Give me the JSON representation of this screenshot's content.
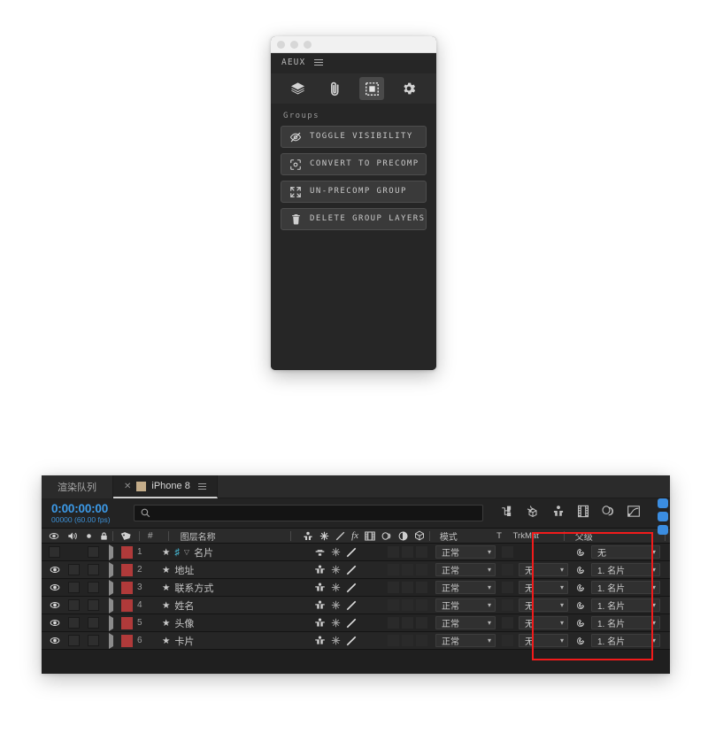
{
  "aeux_panel": {
    "window_controls": [
      "close",
      "minimize",
      "maximize"
    ],
    "title": "AEUX",
    "menu_icon": "hamburger-menu-icon",
    "toolbar_icons": [
      {
        "name": "layers-icon",
        "active": false
      },
      {
        "name": "paperclip-icon",
        "active": false
      },
      {
        "name": "group-selection-icon",
        "active": true
      },
      {
        "name": "gear-icon",
        "active": false
      }
    ],
    "section_label": "Groups",
    "buttons": [
      {
        "icon": "eye-off-icon",
        "label": "TOGGLE VISIBILITY"
      },
      {
        "icon": "precomp-icon",
        "label": "CONVERT TO PRECOMP"
      },
      {
        "icon": "expand-icon",
        "label": "UN-PRECOMP GROUP"
      },
      {
        "icon": "trash-icon",
        "label": "DELETE GROUP LAYERS"
      }
    ]
  },
  "ae_timeline": {
    "tabs": [
      {
        "label": "渲染队列",
        "active": false,
        "closable": false
      },
      {
        "label": "iPhone 8",
        "active": true,
        "closable": true
      }
    ],
    "timecode": "0:00:00:00",
    "frames_fps": "00000 (60.00 fps)",
    "search": {
      "placeholder": "",
      "value": "",
      "icon": "search-icon"
    },
    "toolbar_icons": [
      "composition-mini-flowchart-icon",
      "draft-3d-icon",
      "hide-shy-layers-icon",
      "frame-blending-icon",
      "motion-blur-icon",
      "graph-editor-icon"
    ],
    "column_headers": {
      "av_features": [
        "video-eye-icon",
        "audio-icon",
        "solo-icon",
        "lock-icon"
      ],
      "label": "label-tag-icon",
      "number": "#",
      "layer_name": "图层名称",
      "switches": [
        "shy-icon",
        "collapse-icon",
        "quality-icon",
        "effects-fx-icon",
        "frame-blend-icon",
        "motion-blur-icon",
        "adjustment-icon",
        "3d-icon"
      ],
      "mode": "模式",
      "t": "T",
      "trkmat": "TrkMat",
      "parent": "父级"
    },
    "layers": [
      {
        "num": "1",
        "visible": false,
        "name": "名片",
        "is_composition": true,
        "has_source_tri": true,
        "mode": "正常",
        "trkmat": "",
        "parent": "无",
        "parent_icon": "pickwhip-icon",
        "label_color": "#b03a3a"
      },
      {
        "num": "2",
        "visible": true,
        "name": "地址",
        "is_composition": false,
        "has_source_tri": false,
        "mode": "正常",
        "trkmat": "无",
        "parent": "1. 名片",
        "parent_icon": "pickwhip-icon",
        "label_color": "#b03a3a"
      },
      {
        "num": "3",
        "visible": true,
        "name": "联系方式",
        "is_composition": false,
        "has_source_tri": false,
        "mode": "正常",
        "trkmat": "无",
        "parent": "1. 名片",
        "parent_icon": "pickwhip-icon",
        "label_color": "#b03a3a"
      },
      {
        "num": "4",
        "visible": true,
        "name": "姓名",
        "is_composition": false,
        "has_source_tri": false,
        "mode": "正常",
        "trkmat": "无",
        "parent": "1. 名片",
        "parent_icon": "pickwhip-icon",
        "label_color": "#b03a3a"
      },
      {
        "num": "5",
        "visible": true,
        "name": "头像",
        "is_composition": false,
        "has_source_tri": false,
        "mode": "正常",
        "trkmat": "无",
        "parent": "1. 名片",
        "parent_icon": "pickwhip-icon",
        "label_color": "#b03a3a"
      },
      {
        "num": "6",
        "visible": true,
        "name": "卡片",
        "is_composition": false,
        "has_source_tri": false,
        "mode": "正常",
        "trkmat": "无",
        "parent": "1. 名片",
        "parent_icon": "pickwhip-icon",
        "label_color": "#b03a3a"
      }
    ],
    "annotation": {
      "name": "parent-column-highlight",
      "color": "#f21b1b"
    }
  },
  "colors": {
    "timecode_blue": "#3c9ae8",
    "accent_cyan": "#49c3e0",
    "label_red": "#b03a3a",
    "tab_swatch": "#c4ad8a",
    "annotation_red": "#f21b1b"
  }
}
